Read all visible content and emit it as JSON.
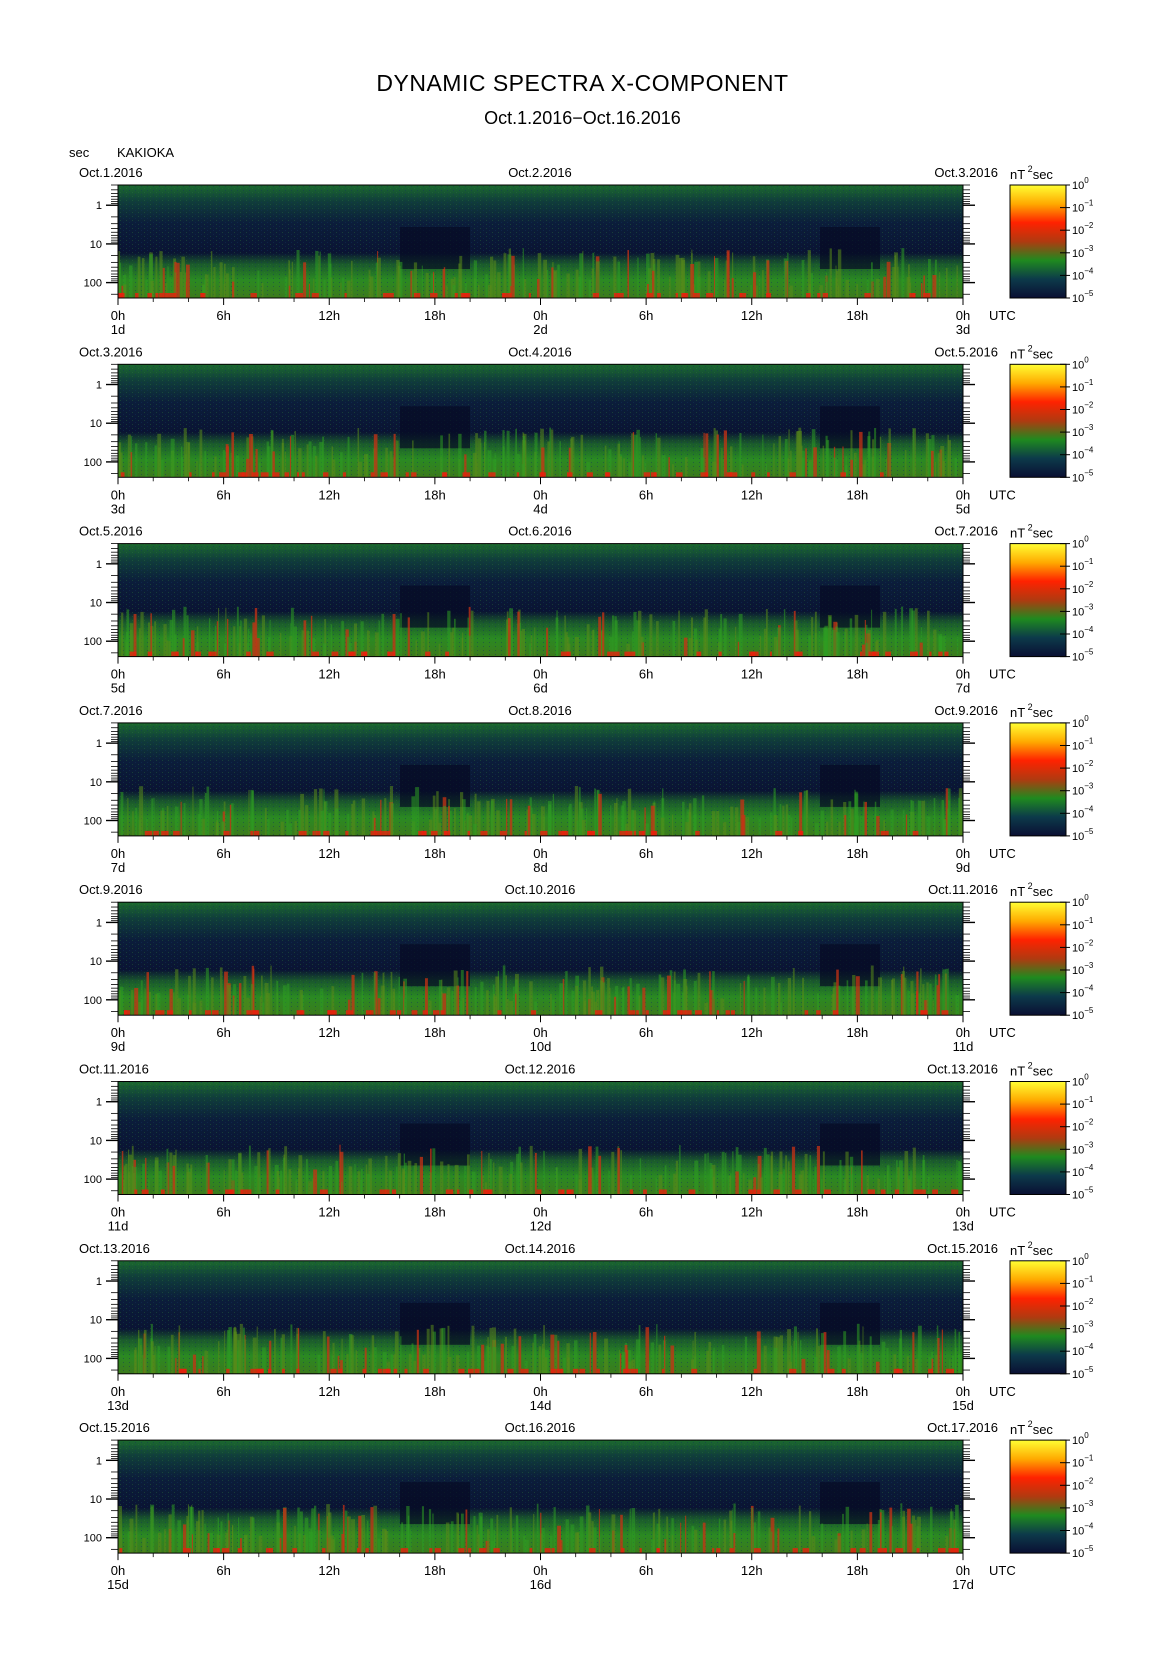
{
  "title": "DYNAMIC SPECTRA X-COMPONENT",
  "subtitle": "Oct.1.2016−Oct.16.2016",
  "y_unit": "sec",
  "station": "KAKIOKA",
  "colorbar_unit": "nT",
  "colorbar_unit_exp": "2",
  "colorbar_unit_suffix": "sec",
  "colorbar_ticks": [
    {
      "base": "10",
      "exp": "0"
    },
    {
      "base": "10",
      "exp": "−1"
    },
    {
      "base": "10",
      "exp": "−2"
    },
    {
      "base": "10",
      "exp": "−3"
    },
    {
      "base": "10",
      "exp": "−4"
    },
    {
      "base": "10",
      "exp": "−5"
    }
  ],
  "colorbar_colors": [
    "#ffff33",
    "#ffaa00",
    "#ff2200",
    "#b03a10",
    "#1f8a1f",
    "#0c3a4a",
    "#0a0f33"
  ],
  "y_ticks": [
    "1",
    "10",
    "100"
  ],
  "x_ticks": [
    "0h",
    "6h",
    "12h",
    "18h",
    "0h",
    "6h",
    "12h",
    "18h",
    "0h"
  ],
  "utc_label": "UTC",
  "chart_data": {
    "type": "heatmap",
    "title": "DYNAMIC SPECTRA X-COMPONENT",
    "ylabel": "sec",
    "y_scale": "log",
    "ylim_sec": [
      0.3,
      250
    ],
    "color_scale": "log",
    "color_range": [
      "10^-5",
      "10^0"
    ],
    "panels": [
      {
        "left_date": "Oct.1.2016",
        "mid_date": "Oct.2.2016",
        "right_date": "Oct.3.2016",
        "day_start": "1d",
        "day_mid": "2d",
        "day_end": "3d"
      },
      {
        "left_date": "Oct.3.2016",
        "mid_date": "Oct.4.2016",
        "right_date": "Oct.5.2016",
        "day_start": "3d",
        "day_mid": "4d",
        "day_end": "5d"
      },
      {
        "left_date": "Oct.5.2016",
        "mid_date": "Oct.6.2016",
        "right_date": "Oct.7.2016",
        "day_start": "5d",
        "day_mid": "6d",
        "day_end": "7d"
      },
      {
        "left_date": "Oct.7.2016",
        "mid_date": "Oct.8.2016",
        "right_date": "Oct.9.2016",
        "day_start": "7d",
        "day_mid": "8d",
        "day_end": "9d"
      },
      {
        "left_date": "Oct.9.2016",
        "mid_date": "Oct.10.2016",
        "right_date": "Oct.11.2016",
        "day_start": "9d",
        "day_mid": "10d",
        "day_end": "11d"
      },
      {
        "left_date": "Oct.11.2016",
        "mid_date": "Oct.12.2016",
        "right_date": "Oct.13.2016",
        "day_start": "11d",
        "day_mid": "12d",
        "day_end": "13d"
      },
      {
        "left_date": "Oct.13.2016",
        "mid_date": "Oct.14.2016",
        "right_date": "Oct.15.2016",
        "day_start": "13d",
        "day_mid": "14d",
        "day_end": "15d"
      },
      {
        "left_date": "Oct.15.2016",
        "mid_date": "Oct.16.2016",
        "right_date": "Oct.17.2016",
        "day_start": "15d",
        "day_mid": "16d",
        "day_end": "17d"
      }
    ]
  }
}
